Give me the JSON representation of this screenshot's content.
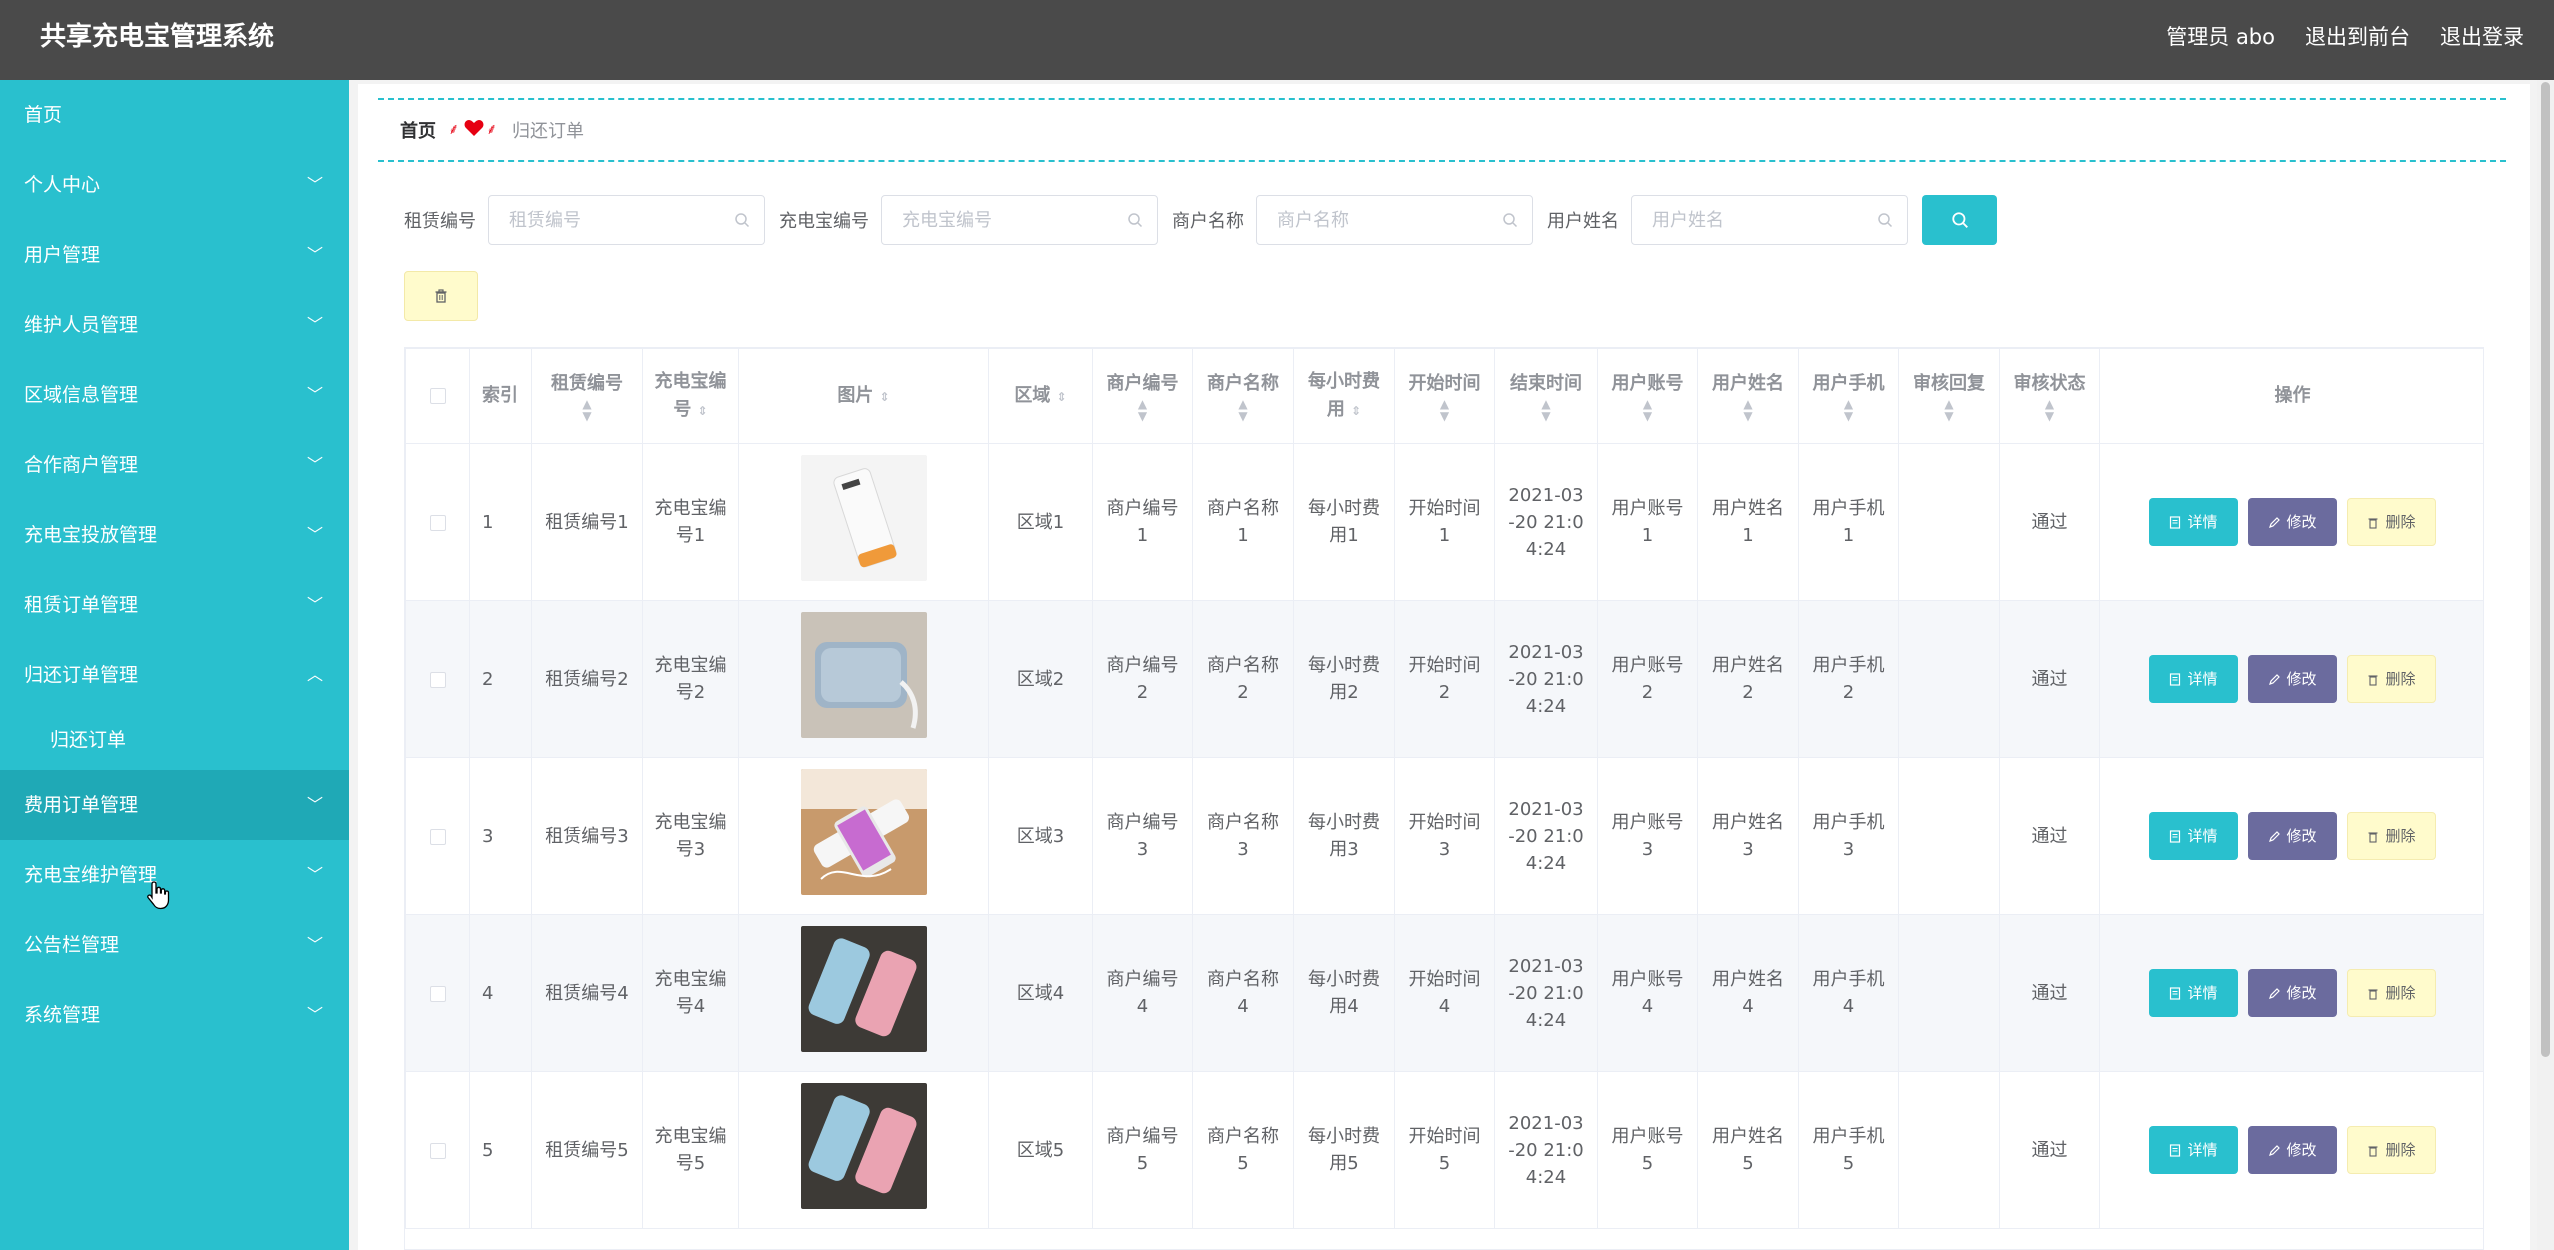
{
  "app": {
    "title": "共享充电宝管理系统"
  },
  "header": {
    "user_label": "管理员 abo",
    "to_frontend": "退出到前台",
    "logout": "退出登录"
  },
  "sidebar": {
    "items": [
      {
        "label": "首页"
      },
      {
        "label": "个人中心"
      },
      {
        "label": "用户管理"
      },
      {
        "label": "维护人员管理"
      },
      {
        "label": "区域信息管理"
      },
      {
        "label": "合作商户管理"
      },
      {
        "label": "充电宝投放管理"
      },
      {
        "label": "租赁订单管理"
      },
      {
        "label": "归还订单管理",
        "expanded": true
      },
      {
        "label": "费用订单管理",
        "hovered": true
      },
      {
        "label": "充电宝维护管理"
      },
      {
        "label": "公告栏管理"
      },
      {
        "label": "系统管理"
      }
    ],
    "submenu": {
      "label": "归还订单"
    }
  },
  "breadcrumb": {
    "home": "首页",
    "current": "归还订单"
  },
  "search": {
    "fields": [
      {
        "label": "租赁编号",
        "placeholder": "租赁编号",
        "value": ""
      },
      {
        "label": "充电宝编号",
        "placeholder": "充电宝编号",
        "value": ""
      },
      {
        "label": "商户名称",
        "placeholder": "商户名称",
        "value": ""
      },
      {
        "label": "用户姓名",
        "placeholder": "用户姓名",
        "value": ""
      }
    ]
  },
  "table": {
    "headers": {
      "index": "索引",
      "rent_no_1": "租赁编号",
      "bank_no_1": "充电宝编",
      "bank_no_2": "号",
      "image": "图片",
      "area": "区域",
      "merchant_no": "商户编号",
      "merchant_name": "商户名称",
      "fee_1": "每小时费",
      "fee_2": "用",
      "start": "开始时间",
      "end": "结束时间",
      "account": "用户账号",
      "username": "用户姓名",
      "phone": "用户手机",
      "reply": "审核回复",
      "status": "审核状态",
      "ops": "操作"
    },
    "rows": [
      {
        "index": "1",
        "rent_no": "租赁编号1",
        "bank_1": "充电宝编",
        "bank_2": "号1",
        "area": "区域1",
        "mno_1": "商户编号",
        "mno_2": "1",
        "mname_1": "商户名称",
        "mname_2": "1",
        "fee_1": "每小时费",
        "fee_2": "用1",
        "start_1": "开始时间",
        "start_2": "1",
        "end_1": "2021-03",
        "end_2": "-20 21:0",
        "end_3": "4:24",
        "acc_1": "用户账号",
        "acc_2": "1",
        "uname_1": "用户姓名",
        "uname_2": "1",
        "phone_1": "用户手机",
        "phone_2": "1",
        "reply": "",
        "status": "通过"
      },
      {
        "index": "2",
        "rent_no": "租赁编号2",
        "bank_1": "充电宝编",
        "bank_2": "号2",
        "area": "区域2",
        "mno_1": "商户编号",
        "mno_2": "2",
        "mname_1": "商户名称",
        "mname_2": "2",
        "fee_1": "每小时费",
        "fee_2": "用2",
        "start_1": "开始时间",
        "start_2": "2",
        "end_1": "2021-03",
        "end_2": "-20 21:0",
        "end_3": "4:24",
        "acc_1": "用户账号",
        "acc_2": "2",
        "uname_1": "用户姓名",
        "uname_2": "2",
        "phone_1": "用户手机",
        "phone_2": "2",
        "reply": "",
        "status": "通过"
      },
      {
        "index": "3",
        "rent_no": "租赁编号3",
        "bank_1": "充电宝编",
        "bank_2": "号3",
        "area": "区域3",
        "mno_1": "商户编号",
        "mno_2": "3",
        "mname_1": "商户名称",
        "mname_2": "3",
        "fee_1": "每小时费",
        "fee_2": "用3",
        "start_1": "开始时间",
        "start_2": "3",
        "end_1": "2021-03",
        "end_2": "-20 21:0",
        "end_3": "4:24",
        "acc_1": "用户账号",
        "acc_2": "3",
        "uname_1": "用户姓名",
        "uname_2": "3",
        "phone_1": "用户手机",
        "phone_2": "3",
        "reply": "",
        "status": "通过"
      },
      {
        "index": "4",
        "rent_no": "租赁编号4",
        "bank_1": "充电宝编",
        "bank_2": "号4",
        "area": "区域4",
        "mno_1": "商户编号",
        "mno_2": "4",
        "mname_1": "商户名称",
        "mname_2": "4",
        "fee_1": "每小时费",
        "fee_2": "用4",
        "start_1": "开始时间",
        "start_2": "4",
        "end_1": "2021-03",
        "end_2": "-20 21:0",
        "end_3": "4:24",
        "acc_1": "用户账号",
        "acc_2": "4",
        "uname_1": "用户姓名",
        "uname_2": "4",
        "phone_1": "用户手机",
        "phone_2": "4",
        "reply": "",
        "status": "通过"
      },
      {
        "index": "5",
        "rent_no": "租赁编号5",
        "bank_1": "充电宝编",
        "bank_2": "号5",
        "area": "区域5",
        "mno_1": "商户编号",
        "mno_2": "5",
        "mname_1": "商户名称",
        "mname_2": "5",
        "fee_1": "每小时费",
        "fee_2": "用5",
        "start_1": "开始时间",
        "start_2": "5",
        "end_1": "2021-03",
        "end_2": "-20 21:0",
        "end_3": "4:24",
        "acc_1": "用户账号",
        "acc_2": "5",
        "uname_1": "用户姓名",
        "uname_2": "5",
        "phone_1": "用户手机",
        "phone_2": "5",
        "reply": "",
        "status": "通过"
      }
    ],
    "actions": {
      "detail": "详情",
      "edit": "修改",
      "delete": "删除"
    }
  },
  "colors": {
    "topbar": "#4a4a4a",
    "sidebar": "#29c0ce",
    "sidebar_hover": "#1fa9b6",
    "accent": "#29c0ce",
    "edit": "#6b6b9e",
    "delete_bg": "#fffbcc",
    "breadcrumb_sep": "#e60012"
  },
  "icons": {
    "search": "search-icon",
    "delete": "trash-icon",
    "detail": "document-icon",
    "edit": "pencil-icon",
    "chevron": "chevron-down-icon",
    "breadcrumb_separator": "heart-icon"
  }
}
